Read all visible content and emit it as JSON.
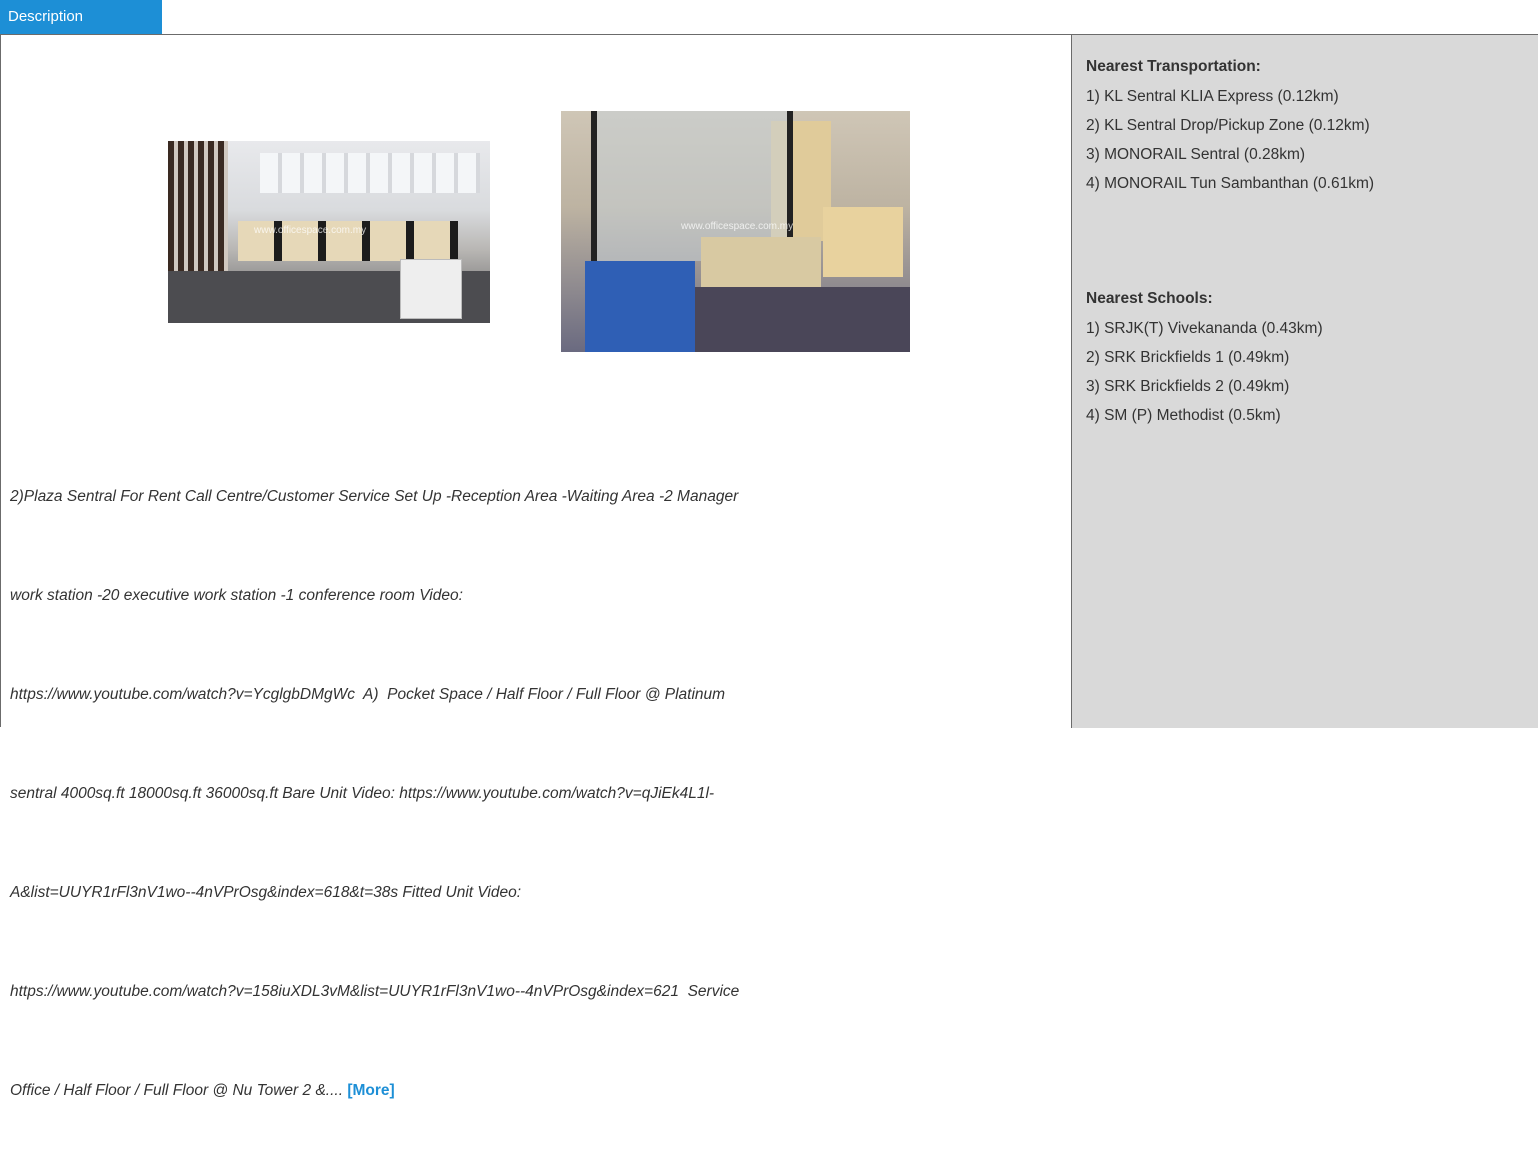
{
  "tab": {
    "label": "Description"
  },
  "photos": {
    "photo1_watermark": "www.officespace.com.my",
    "photo2_watermark": "www.officespace.com.my"
  },
  "description": {
    "lines": [
      "2)Plaza Sentral For Rent Call Centre/Customer Service Set Up -Reception Area -Waiting Area -2 Manager",
      "work station -20 executive work station -1 conference room Video:",
      "https://www.youtube.com/watch?v=YcglgbDMgWc  A)  Pocket Space / Half Floor / Full Floor @ Platinum",
      "sentral 4000sq.ft 18000sq.ft 36000sq.ft Bare Unit Video: https://www.youtube.com/watch?v=qJiEk4L1l-",
      "A&list=UUYR1rFl3nV1wo--4nVPrOsg&index=618&t=38s Fitted Unit Video:",
      "https://www.youtube.com/watch?v=158iuXDL3vM&list=UUYR1rFl3nV1wo--4nVPrOsg&index=621  Service",
      "Office / Half Floor / Full Floor @ Nu Tower 2 &.... "
    ],
    "more_label": "[More]"
  },
  "sidebar": {
    "transportation": {
      "heading": "Nearest Transportation:",
      "items": [
        "1) KL Sentral KLIA Express (0.12km)",
        "2) KL Sentral Drop/Pickup Zone (0.12km)",
        "3) MONORAIL Sentral (0.28km)",
        "4) MONORAIL Tun Sambanthan (0.61km)"
      ]
    },
    "schools": {
      "heading": "Nearest Schools:",
      "items": [
        "1) SRJK(T) Vivekananda (0.43km)",
        "2) SRK Brickfields 1 (0.49km)",
        "3) SRK Brickfields 2 (0.49km)",
        "4) SM (P) Methodist (0.5km)"
      ]
    }
  },
  "colors": {
    "accent": "#1d8fd6",
    "sidebar_bg": "#d9d9d9",
    "border": "#6b6b6b"
  }
}
